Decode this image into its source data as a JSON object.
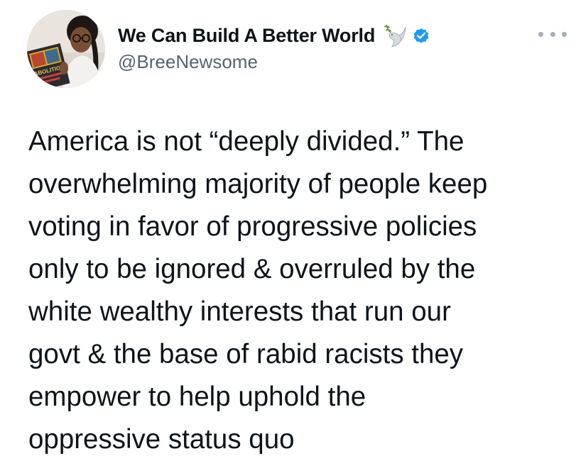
{
  "author": {
    "display_name": "We Can Build A Better World",
    "handle": "@BreeNewsome",
    "avatar_icon": "profile-photo",
    "avatar_book_text": "ABOLITION",
    "name_emoji_icon": "dove-icon",
    "verified_icon": "verified-badge-icon",
    "verified_color": "#1d9bf0"
  },
  "menu": {
    "icon": "more-options-icon"
  },
  "tweet": {
    "text_lines": [
      "America is not “deeply divided.” The",
      "overwhelming majority of people keep",
      "voting in favor of progressive policies",
      "only to be ignored & overruled by the",
      "white wealthy interests that run our",
      "govt & the base of rabid racists they",
      "empower to help uphold the",
      "oppressive status quo"
    ]
  },
  "colors": {
    "text": "#0f1419",
    "secondary": "#536471",
    "background": "#ffffff"
  }
}
